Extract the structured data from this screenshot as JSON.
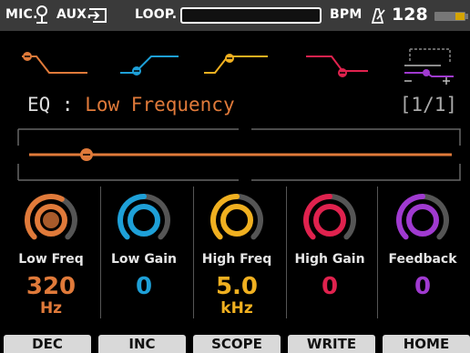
{
  "status_bar": {
    "mic_label": "MIC.",
    "aux_label": "AUX.",
    "loop_label": "LOOP.",
    "bpm_label": "BPM",
    "bpm_value": "128",
    "mic_icon": "microphone-icon",
    "aux_icon": "aux-input-icon",
    "metronome_icon": "metronome-icon",
    "battery_icon": "battery-icon"
  },
  "eq_bands": [
    {
      "name": "low-shelf",
      "color": "#e07a3a",
      "selected": true
    },
    {
      "name": "low-mid-peak",
      "color": "#1ea0d8",
      "selected": false
    },
    {
      "name": "high-mid-peak",
      "color": "#f0b020",
      "selected": false
    },
    {
      "name": "high-cut",
      "color": "#e0224e",
      "selected": false
    },
    {
      "name": "feedback-suppressor",
      "color": "#a03ad0",
      "selected": false
    }
  ],
  "eq_header": {
    "prefix": "EQ :",
    "value": "Low Frequency",
    "page": "[1/1]"
  },
  "slider": {
    "position": 0.14,
    "color": "#e07a3a"
  },
  "knobs": [
    {
      "label": "Low Freq",
      "value": "320",
      "unit": "Hz",
      "color": "#e07a3a",
      "level": 0.6
    },
    {
      "label": "Low Gain",
      "value": "0",
      "unit": "",
      "color": "#1ea0d8",
      "level": 0.5
    },
    {
      "label": "High Freq",
      "value": "5.0",
      "unit": "kHz",
      "color": "#f0b020",
      "level": 0.5
    },
    {
      "label": "High Gain",
      "value": "0",
      "unit": "",
      "color": "#e0224e",
      "level": 0.5
    },
    {
      "label": "Feedback",
      "value": "0",
      "unit": "",
      "color": "#a03ad0",
      "level": 0.5
    }
  ],
  "softkeys": [
    "DEC",
    "INC",
    "SCOPE",
    "WRITE",
    "HOME"
  ]
}
